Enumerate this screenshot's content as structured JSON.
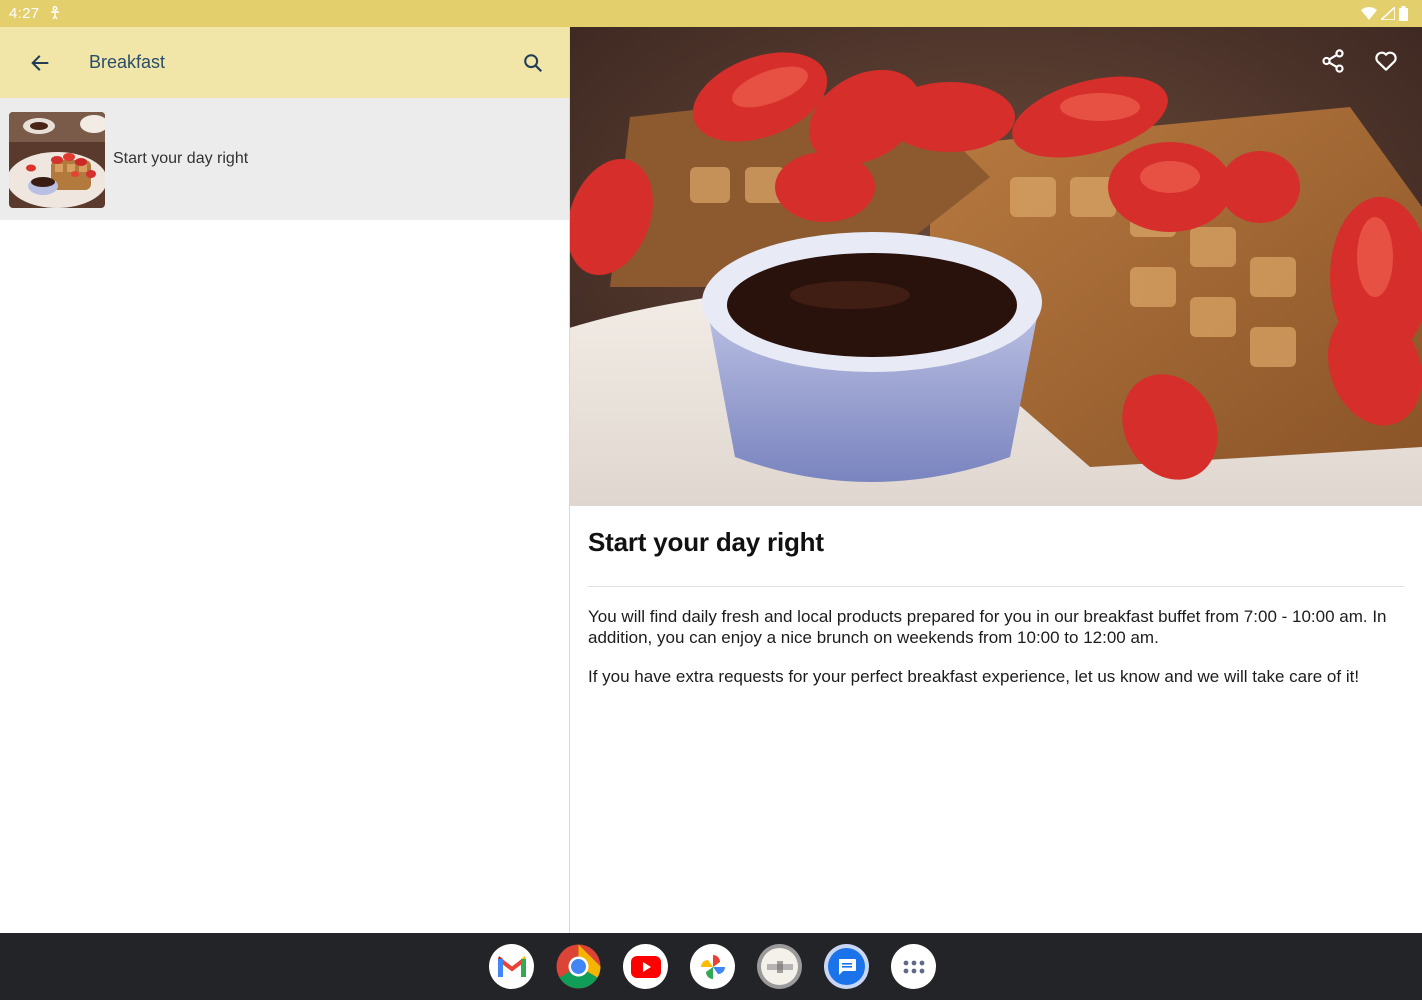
{
  "status_bar": {
    "time": "4:27"
  },
  "app_bar": {
    "title": "Breakfast"
  },
  "list": {
    "items": [
      {
        "label": "Start your day right"
      }
    ]
  },
  "detail": {
    "title": "Start your day right",
    "paragraphs": [
      "You will find daily fresh and local products prepared for you in our breakfast buffet from 7:00 - 10:00 am. In addition, you can enjoy a nice brunch on weekends from 10:00 to 12:00 am.",
      "If you have extra requests for your perfect breakfast experience, let us know and we will take care of it!"
    ]
  },
  "dock": {
    "apps": [
      "gmail-icon",
      "chrome-icon",
      "youtube-icon",
      "photos-icon",
      "app-icon",
      "messages-icon",
      "app-drawer-icon"
    ]
  },
  "colors": {
    "status_bar": "#e4cf6d",
    "app_bar": "#f1e5a8",
    "app_bar_text": "#2a4d6b",
    "selected_item": "#ececec",
    "taskbar": "#232427"
  }
}
